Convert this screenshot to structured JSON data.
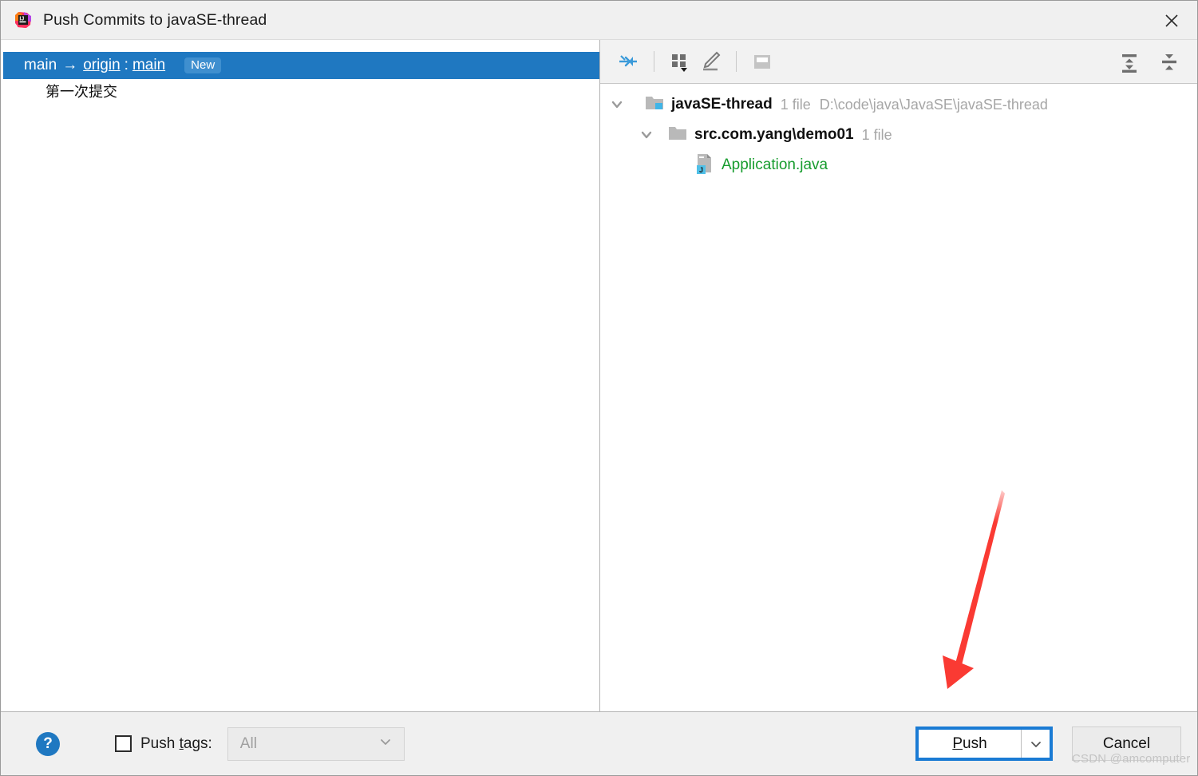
{
  "window": {
    "title": "Push Commits to javaSE-thread",
    "app_icon": "intellij-idea-icon",
    "close_icon": "close-icon"
  },
  "commits_panel": {
    "selected_row": {
      "source_branch": "main",
      "arrow": "→",
      "remote": "origin",
      "colon": ":",
      "target_branch": "main",
      "badge": "New",
      "badge_color": "#3f8fcf",
      "row_color": "#1f78c1"
    },
    "commit_message": "第一次提交"
  },
  "details_toolbar": {
    "buttons": [
      {
        "name": "show-diff-icon",
        "label": "Show Diff"
      },
      {
        "name": "group-by-icon",
        "label": "Group By"
      },
      {
        "name": "edit-source-icon",
        "label": "Edit Source"
      },
      {
        "name": "preview-icon",
        "label": "Preview Diff"
      }
    ],
    "right_buttons": [
      {
        "name": "expand-all-icon",
        "label": "Expand All"
      },
      {
        "name": "collapse-all-icon",
        "label": "Collapse All"
      }
    ]
  },
  "file_tree": {
    "nodes": [
      {
        "name": "javaSE-thread",
        "count": "1 file",
        "path": "D:\\code\\java\\JavaSE\\javaSE-thread",
        "icon": "module-folder-icon",
        "expanded": true,
        "depth": 0
      },
      {
        "name": "src.com.yang\\demo01",
        "count": "1 file",
        "path": "",
        "icon": "folder-icon",
        "expanded": true,
        "depth": 1
      },
      {
        "name": "Application.java",
        "count": "",
        "path": "",
        "icon": "java-file-icon",
        "expanded": null,
        "depth": 2,
        "color": "#179c2e"
      }
    ]
  },
  "bottom_bar": {
    "help_label": "?",
    "push_tags_checkbox_checked": false,
    "push_tags_label_before": "Push ",
    "push_tags_label_mnemonic": "t",
    "push_tags_label_after": "ags:",
    "tags_combo_value": "All",
    "push_button_mnemonic": "P",
    "push_button_rest": "ush",
    "push_dropdown_icon": "chevron-down-icon",
    "cancel_button_label": "Cancel",
    "focus_color": "#1a7bd4"
  },
  "annotation": {
    "arrow_color": "#fa3a33",
    "watermark": "CSDN @amcomputer"
  }
}
